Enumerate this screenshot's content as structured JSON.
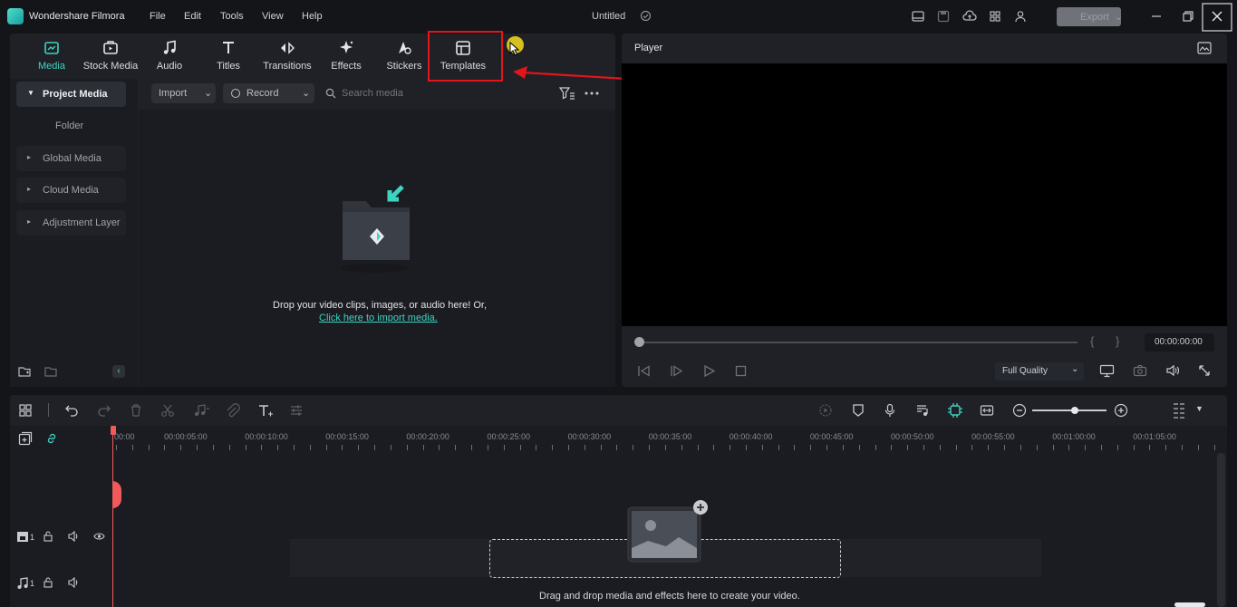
{
  "titlebar": {
    "app_name": "Wondershare Filmora",
    "menus": [
      "File",
      "Edit",
      "Tools",
      "View",
      "Help"
    ],
    "doc_title": "Untitled",
    "export_label": "Export"
  },
  "media_tabs": [
    {
      "label": "Media",
      "icon": "media-icon",
      "active": true
    },
    {
      "label": "Stock Media",
      "icon": "stock-media-icon",
      "active": false
    },
    {
      "label": "Audio",
      "icon": "music-note-icon",
      "active": false
    },
    {
      "label": "Titles",
      "icon": "text-t-icon",
      "active": false
    },
    {
      "label": "Transitions",
      "icon": "transitions-icon",
      "active": false
    },
    {
      "label": "Effects",
      "icon": "sparkle-icon",
      "active": false
    },
    {
      "label": "Stickers",
      "icon": "sticker-icon",
      "active": false
    },
    {
      "label": "Templates",
      "icon": "templates-icon",
      "active": false
    }
  ],
  "sidebar": {
    "items": [
      {
        "label": "Project Media",
        "active": true
      },
      {
        "label": "Folder",
        "active": false
      },
      {
        "label": "Global Media",
        "active": false
      },
      {
        "label": "Cloud Media",
        "active": false
      },
      {
        "label": "Adjustment Layer",
        "active": false
      }
    ]
  },
  "media_toolbar": {
    "import_label": "Import",
    "record_label": "Record",
    "search_placeholder": "Search media"
  },
  "dropzone": {
    "text": "Drop your video clips, images, or audio here! Or,",
    "link": "Click here to import media."
  },
  "player": {
    "title": "Player",
    "timecode": "00:00:00:00",
    "quality": "Full Quality"
  },
  "timeline": {
    "ruler_labels": [
      "00:00",
      "00:00:05:00",
      "00:00:10:00",
      "00:00:15:00",
      "00:00:20:00",
      "00:00:25:00",
      "00:00:30:00",
      "00:00:35:00",
      "00:00:40:00",
      "00:00:45:00",
      "00:00:50:00",
      "00:00:55:00",
      "00:01:00:00",
      "00:01:05:00"
    ],
    "video_track_number": "1",
    "audio_track_number": "1",
    "empty_hint": "Drag and drop media and effects here to create your video."
  },
  "colors": {
    "accent": "#3fd3c2",
    "annotation_red": "#e0161c",
    "playhead": "#f05a5a"
  }
}
